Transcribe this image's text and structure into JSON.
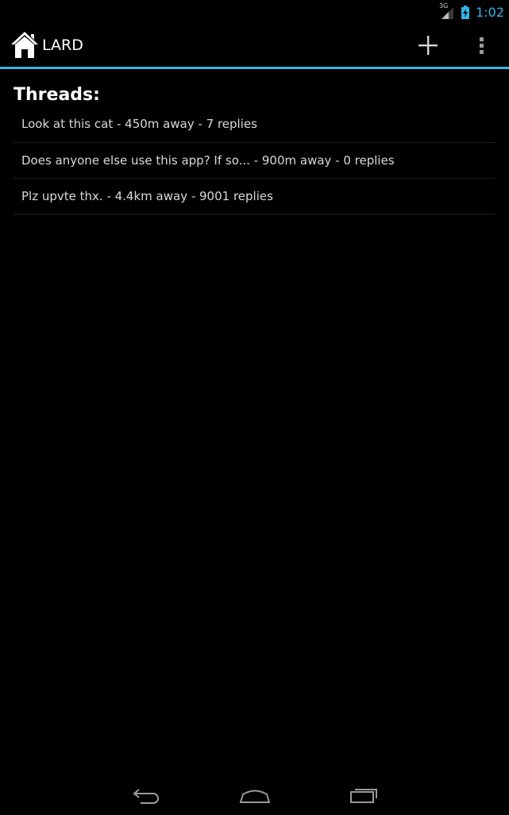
{
  "status_bar": {
    "network_type": "3G",
    "time": "1:02",
    "icons": [
      "signal-icon",
      "battery-charging-icon"
    ]
  },
  "action_bar": {
    "app_icon": "home-icon",
    "title": "LARD",
    "actions": [
      "add-icon",
      "overflow-menu-icon"
    ]
  },
  "main": {
    "section_title": "Threads:",
    "threads": [
      {
        "label": "Look at this cat - 450m away - 7 replies"
      },
      {
        "label": "Does anyone else use this app? If so... - 900m away - 0 replies"
      },
      {
        "label": "Plz upvte thx. - 4.4km away - 9001 replies"
      }
    ]
  },
  "nav_bar": {
    "buttons": [
      "back-icon",
      "home-icon",
      "recent-apps-icon"
    ]
  },
  "colors": {
    "accent": "#33b5e5",
    "background": "#000000",
    "text_primary": "#ffffff",
    "text_secondary": "#d8d8d8"
  }
}
